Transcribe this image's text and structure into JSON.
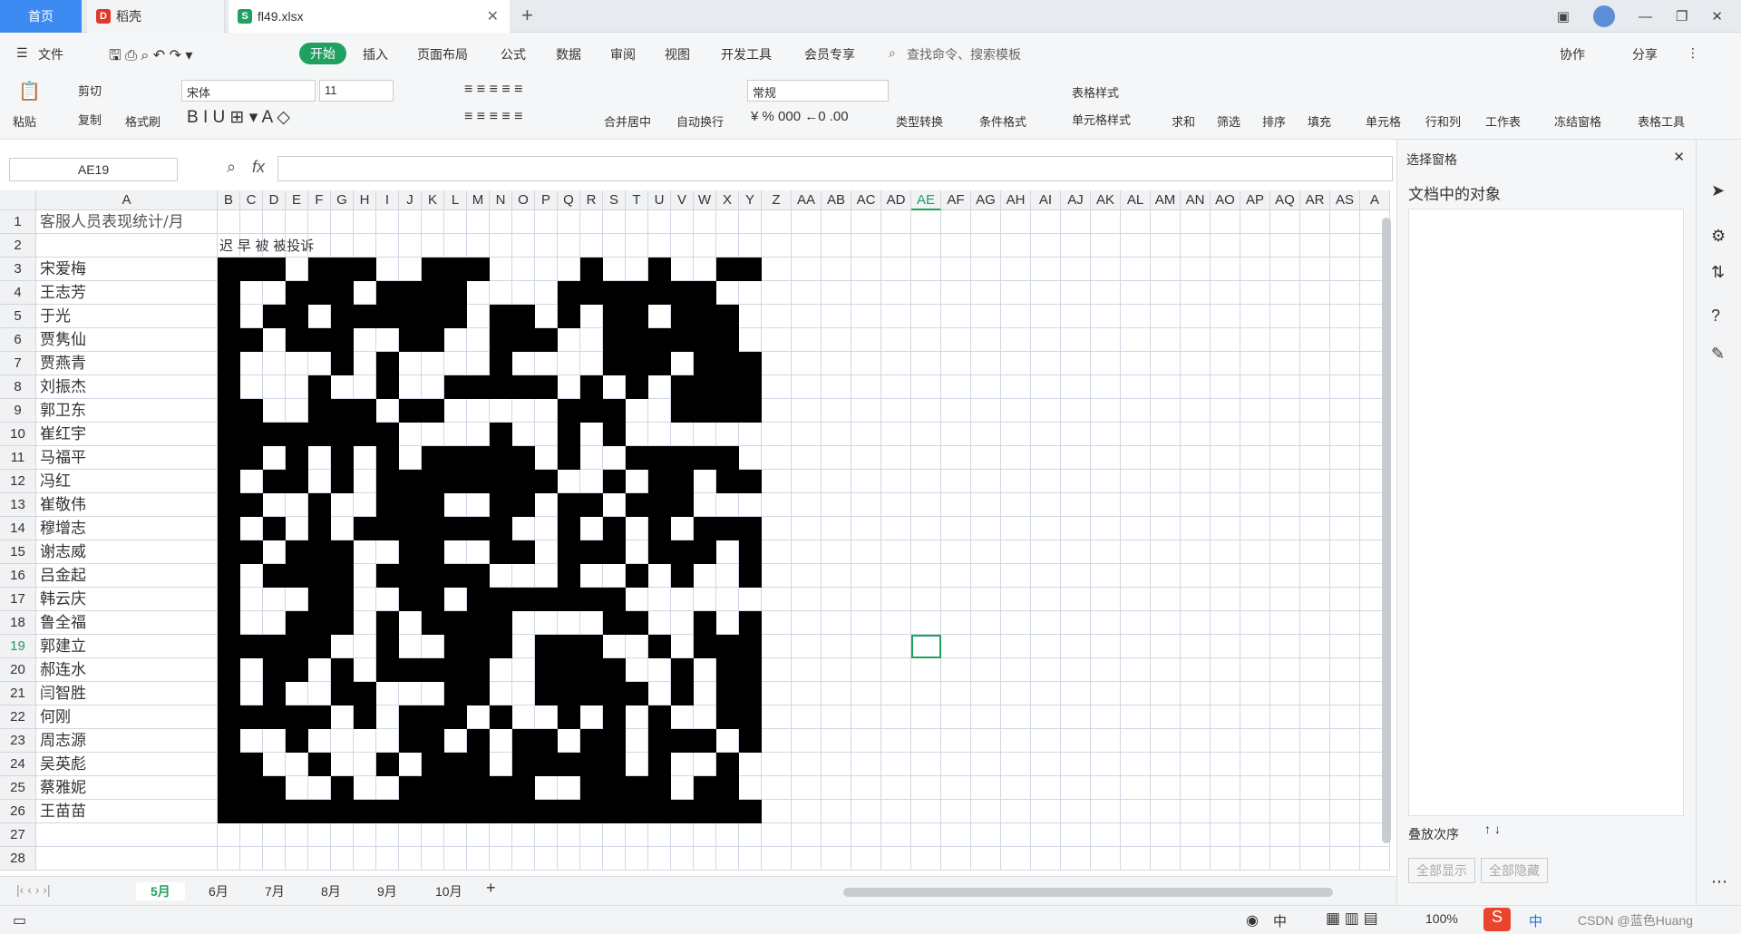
{
  "tabs": {
    "home": "首页",
    "daoke": "稻壳",
    "file": "fl49.xlsx"
  },
  "menus": [
    "文件",
    "开始",
    "插入",
    "页面布局",
    "公式",
    "数据",
    "审阅",
    "视图",
    "开发工具",
    "会员专享"
  ],
  "search": "查找命令、搜索模板",
  "collab": "协作",
  "share": "分享",
  "toolbar": {
    "paste": "粘贴",
    "cut": "剪切",
    "copy": "复制",
    "format_painter": "格式刷",
    "font": "宋体",
    "size": "11",
    "number_format": "常规",
    "merge": "合并居中",
    "wrap": "自动换行",
    "type_convert": "类型转换",
    "cond_format": "条件格式",
    "table_style": "表格样式",
    "cell_style": "单元格样式",
    "sum": "求和",
    "filter": "筛选",
    "sort": "排序",
    "fill": "填充",
    "cells": "单元格",
    "rowcol": "行和列",
    "sheet": "工作表",
    "freeze": "冻结窗格",
    "tools": "表格工具"
  },
  "namebox": "AE19",
  "sheet": {
    "title": "客服人员表现统计/月",
    "subheader": "迟 早 被 被投诉",
    "rows": [
      "宋爱梅",
      "王志芳",
      "于光",
      "贾隽仙",
      "贾燕青",
      "刘振杰",
      "郭卫东",
      "崔红宇",
      "马福平",
      "冯红",
      "崔敬伟",
      "穆增志",
      "谢志威",
      "吕金起",
      "韩云庆",
      "鲁全福",
      "郭建立",
      "郝连水",
      "闫智胜",
      "何刚",
      "周志源",
      "吴英彪",
      "蔡雅妮",
      "王苗苗"
    ],
    "columns": [
      "A",
      "B",
      "C",
      "D",
      "E",
      "F",
      "G",
      "H",
      "I",
      "J",
      "K",
      "L",
      "M",
      "N",
      "O",
      "P",
      "Q",
      "R",
      "S",
      "T",
      "U",
      "V",
      "W",
      "X",
      "Y",
      "Z",
      "AA",
      "AB",
      "AC",
      "AD",
      "AE",
      "AF",
      "AG",
      "AH",
      "AI",
      "AJ",
      "AK",
      "AL",
      "AM",
      "AN",
      "AO",
      "AP",
      "AQ",
      "AR",
      "AS",
      "A"
    ]
  },
  "sheet_tabs": [
    "5月",
    "6月",
    "7月",
    "8月",
    "9月",
    "10月"
  ],
  "panel": {
    "title": "选择窗格",
    "section": "文档中的对象",
    "order": "叠放次序",
    "show_all": "全部显示",
    "hide_all": "全部隐藏"
  },
  "status": {
    "zoom": "100%",
    "ime": "中",
    "watermark": "CSDN @蓝色Huang"
  }
}
